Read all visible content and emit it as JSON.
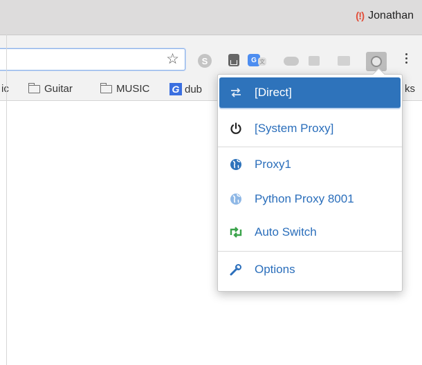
{
  "window": {
    "profile_name": "Jonathan",
    "profile_icon": "!"
  },
  "toolbar": {
    "omnibox_value": "",
    "star_glyph": "☆",
    "extensions": [
      {
        "name": "skype-extension-icon",
        "glyph": "S"
      },
      {
        "name": "save-extension-icon",
        "glyph": ""
      },
      {
        "name": "translate-extension-icon",
        "glyph": "G"
      },
      {
        "name": "cloud-extension-icon",
        "glyph": ""
      },
      {
        "name": "grey-extension-icon",
        "glyph": ""
      },
      {
        "name": "grey-extension-icon",
        "glyph": ""
      },
      {
        "name": "proxy-switch-extension-icon",
        "glyph": ""
      }
    ]
  },
  "bookmarks": {
    "items": [
      {
        "label": "ic"
      },
      {
        "label": "Guitar"
      },
      {
        "label": "MUSIC"
      },
      {
        "label": "dub"
      },
      {
        "label": "ks"
      }
    ],
    "g_mark": "G"
  },
  "popup": {
    "items": [
      {
        "label": "[Direct]",
        "icon": "swap-arrows-icon",
        "active": true
      },
      {
        "label": "[System Proxy]",
        "icon": "power-icon",
        "active": false
      },
      {
        "label": "Proxy1",
        "icon": "globe-icon",
        "active": false
      },
      {
        "label": "Python Proxy 8001",
        "icon": "globe-icon",
        "active": false
      },
      {
        "label": "Auto Switch",
        "icon": "retweet-icon",
        "active": false
      },
      {
        "label": "Options",
        "icon": "wrench-icon",
        "active": false
      }
    ]
  },
  "colors": {
    "accent": "#2e73bb",
    "link": "#2a6ebb",
    "auto_switch_icon": "#3aa34a",
    "proxy1_globe": "#2e73bb",
    "python_globe": "#8fb8e6"
  }
}
